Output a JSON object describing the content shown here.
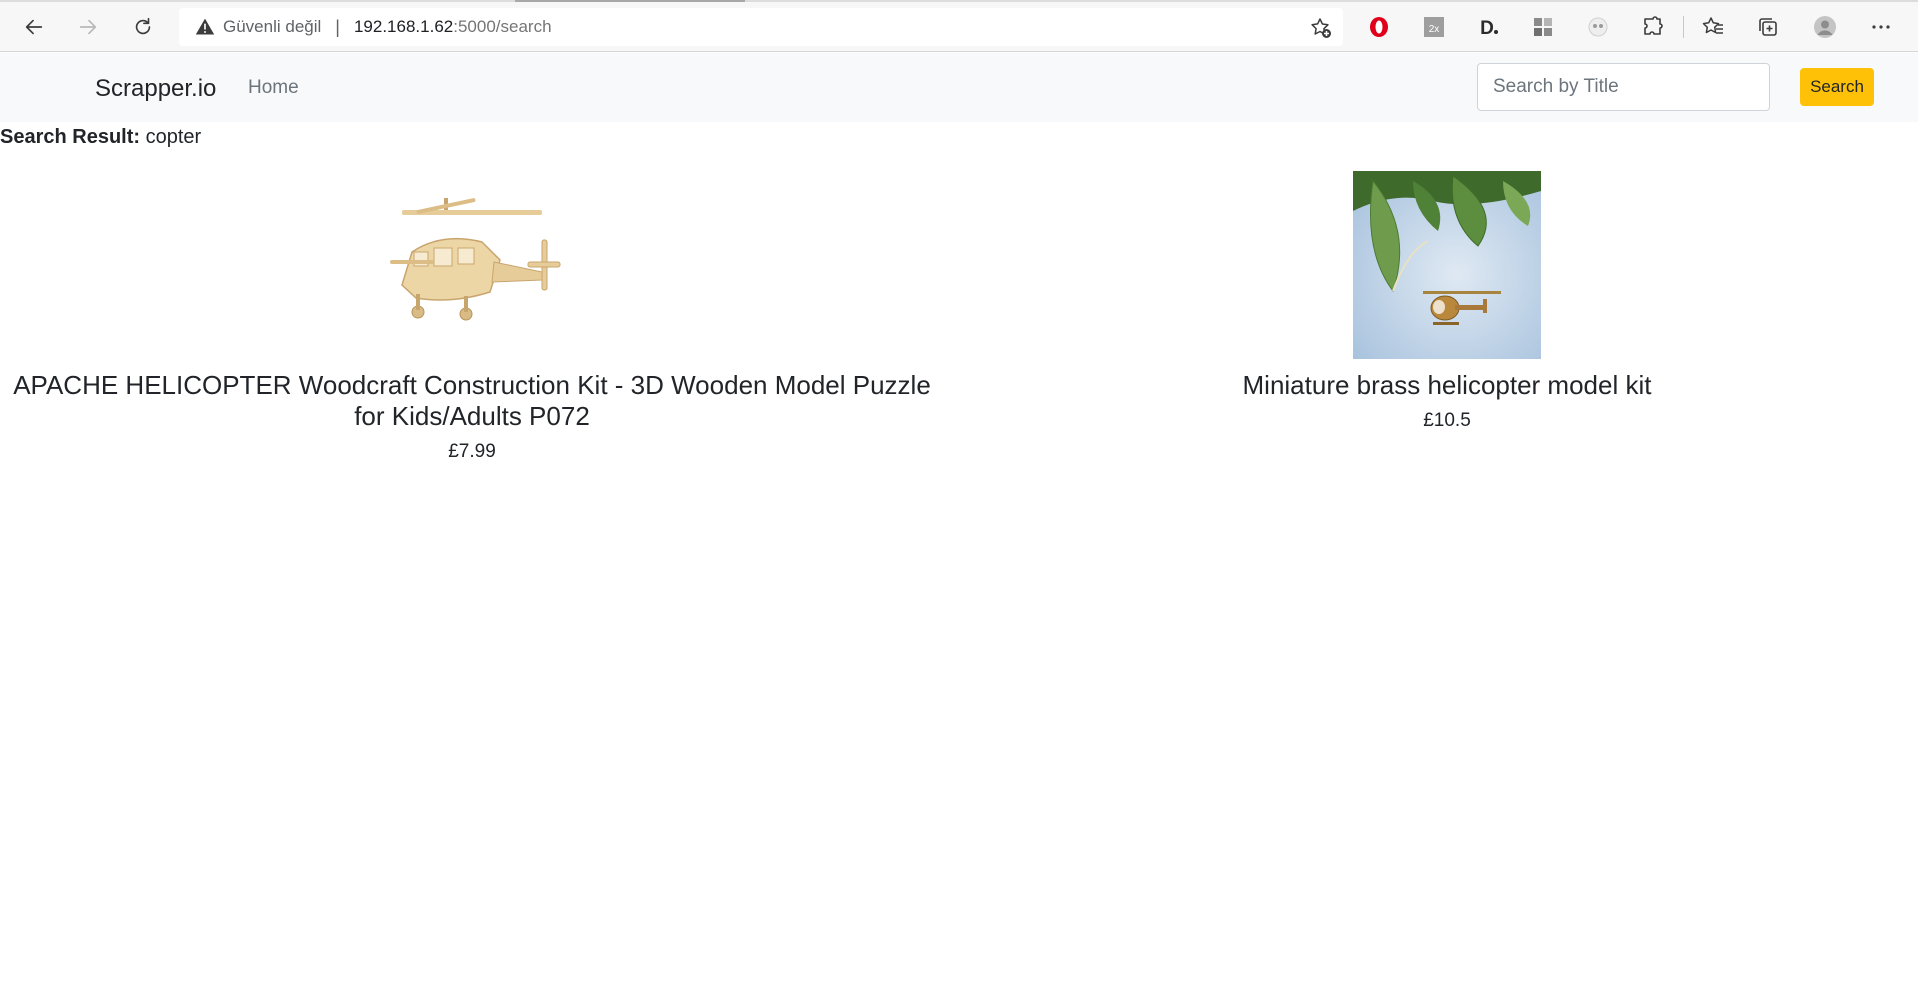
{
  "browser": {
    "security_label": "Güvenli değil",
    "url_host": "192.168.1.62",
    "url_path": ":5000/search",
    "icons": [
      "back-icon",
      "forward-icon",
      "reload-icon",
      "warning-icon",
      "add-favorite-icon",
      "opera-icon",
      "twox-icon",
      "d-icon",
      "grid-icon",
      "panda-icon",
      "extensions-icon",
      "favorites-icon",
      "collections-icon",
      "profile-icon",
      "more-icon"
    ]
  },
  "navbar": {
    "brand": "Scrapper.io",
    "home_label": "Home",
    "search_placeholder": "Search by Title",
    "search_button": "Search",
    "accent_color": "#ffc107"
  },
  "search": {
    "result_label": "Search Result:",
    "query": "copter"
  },
  "products": [
    {
      "title": "APACHE HELICOPTER Woodcraft Construction Kit - 3D Wooden Model Puzzle for Kids/Adults P072",
      "price": "£7.99"
    },
    {
      "title": "Miniature brass helicopter model kit",
      "price": "£10.5"
    }
  ]
}
